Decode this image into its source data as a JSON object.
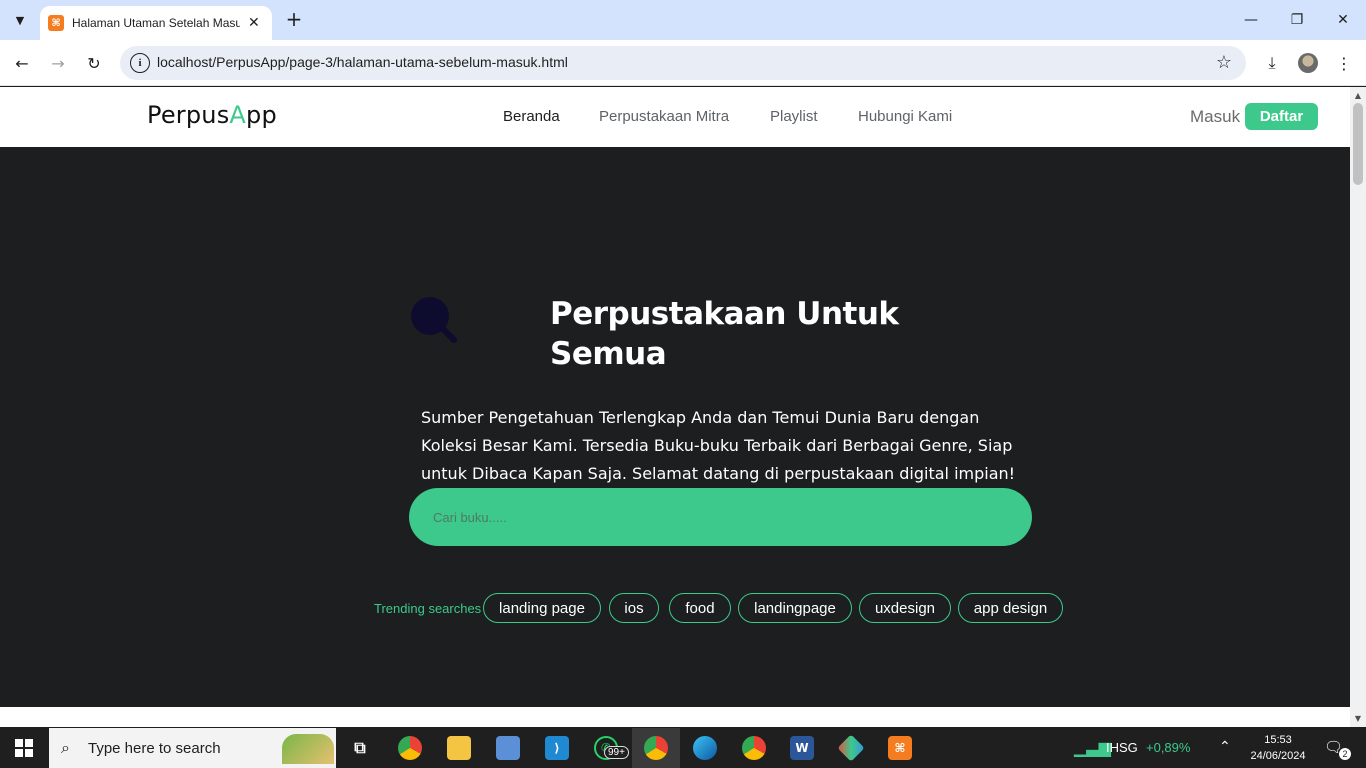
{
  "browser": {
    "tab_title": "Halaman Utaman Setelah Masuk",
    "url": "localhost/PerpusApp/page-3/halaman-utama-sebelum-masuk.html"
  },
  "site": {
    "brand_prefix": "Perpus",
    "brand_accent": "A",
    "brand_suffix": "pp",
    "nav": [
      "Beranda",
      "Perpustakaan Mitra",
      "Playlist",
      "Hubungi Kami"
    ],
    "login": "Masuk",
    "register": "Daftar"
  },
  "hero": {
    "title": "Perpustakaan Untuk Semua",
    "description": "Sumber Pengetahuan Terlengkap Anda dan Temui Dunia Baru dengan Koleksi Besar Kami. Tersedia Buku-buku Terbaik dari Berbagai Genre, Siap untuk Dibaca Kapan Saja. Selamat datang di perpustakaan digital impian!",
    "search_placeholder": "Cari buku.....",
    "trending_label": "Trending searches",
    "trending": [
      "landing page",
      "ios",
      "food",
      "landingpage",
      "uxdesign",
      "app design"
    ]
  },
  "taskbar": {
    "search_placeholder": "Type here to search",
    "whatsapp_badge": "99+",
    "stock_name": "IHSG",
    "stock_change": "+0,89%",
    "time": "15:53",
    "date": "24/06/2024",
    "notifications": "2"
  },
  "colors": {
    "accent": "#3cc98b",
    "page_bg": "#1c1e1f"
  }
}
